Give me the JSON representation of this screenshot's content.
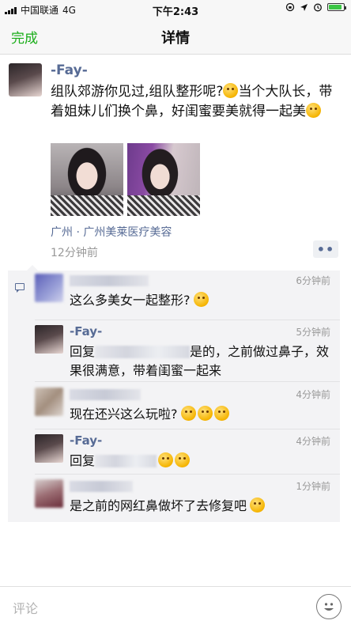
{
  "status_bar": {
    "carrier": "中国联通",
    "network": "4G",
    "time": "下午2:43",
    "battery_level": 0.9
  },
  "nav": {
    "back_label": "完成",
    "title": "详情"
  },
  "post": {
    "username": "-Fay-",
    "text_parts": [
      "组队郊游你见过,组队整形呢?",
      "当个大队长，带着姐妹儿们换个鼻，好闺蜜要美就得一起美"
    ],
    "location": "广州 · 广州美莱医疗美容",
    "time": "12分钟前",
    "more_label": "••"
  },
  "comments": [
    {
      "username": "",
      "time": "6分钟前",
      "text": "这么多美女一起整形?"
    },
    {
      "username": "-Fay-",
      "time": "5分钟前",
      "reply_word": "回复",
      "text": "是的，之前做过鼻子，效果很满意，带着闺蜜一起来"
    },
    {
      "username": "",
      "time": "4分钟前",
      "text": "现在还兴这么玩啦?"
    },
    {
      "username": "-Fay-",
      "time": "4分钟前",
      "reply_word": "回复"
    },
    {
      "username": "",
      "time": "1分钟前",
      "text": "是之前的网红鼻做坏了去修复吧"
    }
  ],
  "input": {
    "placeholder": "评论"
  },
  "icons": {
    "comment": "comment-icon",
    "emoji": "emoji-icon"
  },
  "colors": {
    "accent_green": "#1aad19",
    "link_blue": "#576b95"
  }
}
